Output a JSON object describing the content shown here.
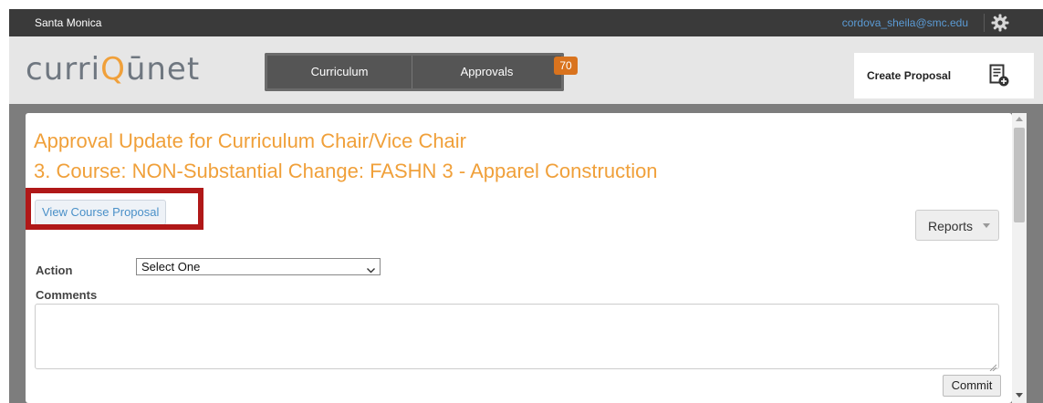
{
  "topbar": {
    "org_name": "Santa Monica",
    "user_email": "cordova_sheila@smc.edu",
    "settings_icon": "gear-icon"
  },
  "header": {
    "logo_part1": "curri",
    "logo_accent": "Q",
    "logo_part2": "ūnet",
    "nav": {
      "curriculum_label": "Curriculum",
      "approvals_label": "Approvals",
      "approvals_badge": "70"
    },
    "create_proposal_label": "Create Proposal",
    "create_proposal_icon": "document-add-icon"
  },
  "main": {
    "title_line1": "Approval Update for Curriculum Chair/Vice Chair",
    "title_line2": "3. Course: NON-Substantial Change: FASHN 3 - Apparel Construction",
    "view_course_proposal_label": "View Course Proposal",
    "reports_label": "Reports",
    "action_label": "Action",
    "action_selected": "Select One",
    "comments_label": "Comments",
    "comments_value": "",
    "commit_label": "Commit"
  },
  "colors": {
    "accent": "#f0a03a",
    "badge": "#d9731e",
    "highlight": "#b01818",
    "link": "#4a90c8"
  }
}
